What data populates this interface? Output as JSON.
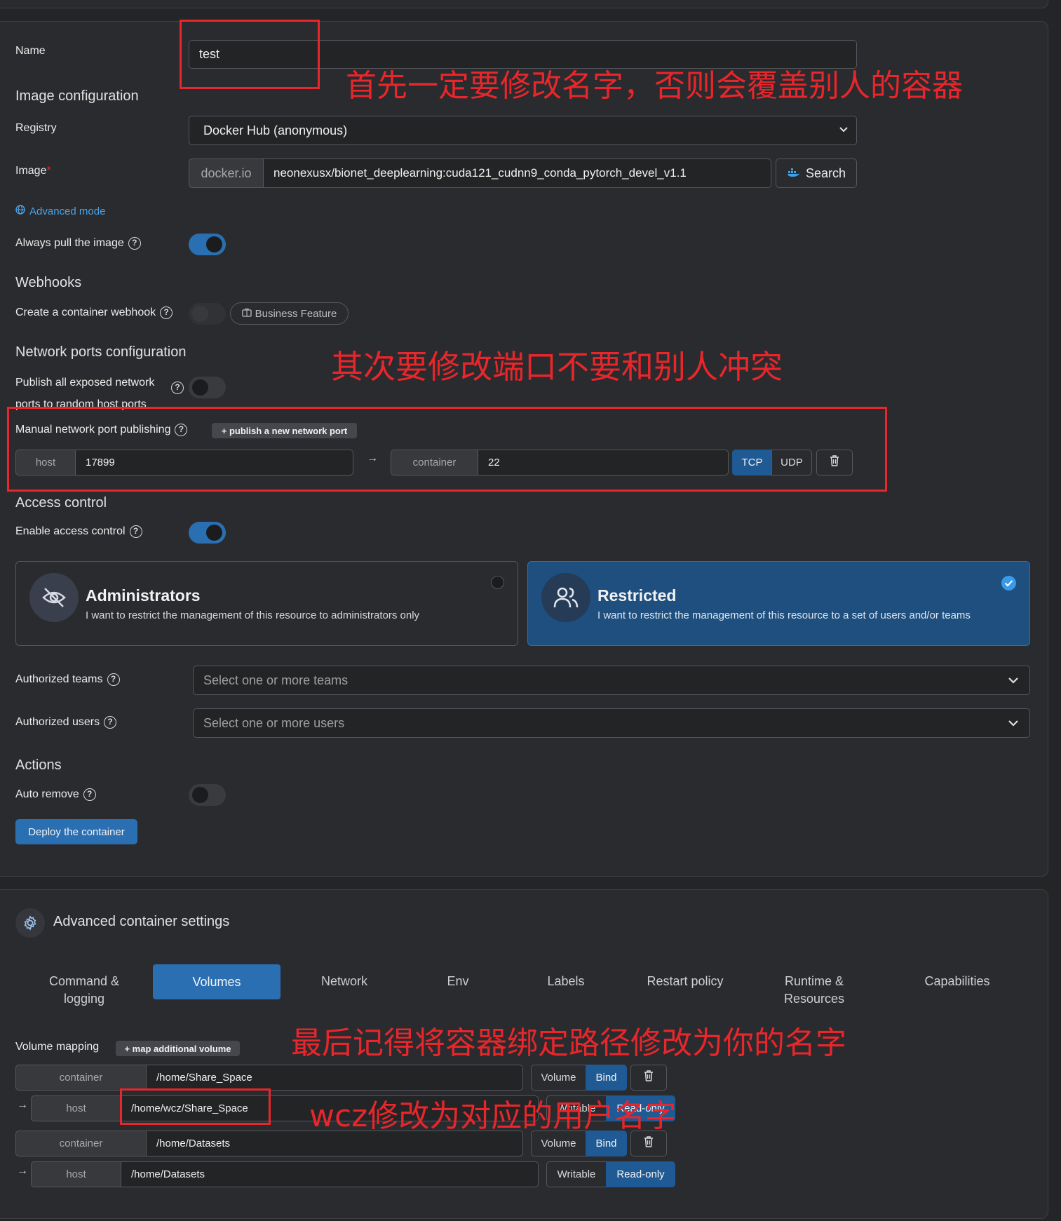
{
  "form": {
    "name_label": "Name",
    "name_value": "test",
    "image_config_title": "Image configuration",
    "registry_label": "Registry",
    "registry_value": "Docker Hub (anonymous)",
    "image_label": "Image",
    "image_required": "*",
    "image_prefix": "docker.io",
    "image_value": "neonexusx/bionet_deeplearning:cuda121_cudnn9_conda_pytorch_devel_v1.1",
    "search_label": "Search",
    "advanced_mode_label": "Advanced mode",
    "always_pull_label": "Always pull the image",
    "always_pull_on": true,
    "webhooks_title": "Webhooks",
    "webhook_label": "Create a container webhook",
    "business_feature_label": "Business Feature",
    "network_title": "Network ports configuration",
    "publish_all_label_1": "Publish all exposed network",
    "publish_all_label_2": "ports to random host ports",
    "manual_publish_label": "Manual network port publishing",
    "publish_new_port_label": "+ publish a new network port",
    "port_host_label": "host",
    "port_host_value": "17899",
    "port_container_label": "container",
    "port_container_value": "22",
    "tcp_label": "TCP",
    "udp_label": "UDP",
    "access_title": "Access control",
    "enable_access_label": "Enable access control",
    "admins_title": "Administrators",
    "admins_desc": "I want to restrict the management of this resource to administrators only",
    "restricted_title": "Restricted",
    "restricted_desc": "I want to restrict the management of this resource to a set of users and/or teams",
    "teams_label": "Authorized teams",
    "teams_placeholder": "Select one or more teams",
    "users_label": "Authorized users",
    "users_placeholder": "Select one or more users",
    "actions_title": "Actions",
    "auto_remove_label": "Auto remove",
    "deploy_label": "Deploy the container"
  },
  "advanced": {
    "title": "Advanced container settings",
    "tabs": [
      {
        "label_1": "Command &",
        "label_2": "logging"
      },
      {
        "label_1": "Volumes",
        "label_2": ""
      },
      {
        "label_1": "Network",
        "label_2": ""
      },
      {
        "label_1": "Env",
        "label_2": ""
      },
      {
        "label_1": "Labels",
        "label_2": ""
      },
      {
        "label_1": "Restart policy",
        "label_2": ""
      },
      {
        "label_1": "Runtime &",
        "label_2": "Resources"
      },
      {
        "label_1": "Capabilities",
        "label_2": ""
      }
    ],
    "active_tab": "Volumes",
    "volume_mapping_label": "Volume mapping",
    "map_volume_label": "+ map additional volume",
    "volumes": [
      {
        "container_label": "container",
        "container_value": "/home/Share_Space",
        "volume_label": "Volume",
        "bind_label": "Bind",
        "host_label": "host",
        "host_value": "/home/wcz/Share_Space",
        "writable_label": "Writable",
        "readonly_label": "Read-only"
      },
      {
        "container_label": "container",
        "container_value": "/home/Datasets",
        "volume_label": "Volume",
        "bind_label": "Bind",
        "host_label": "host",
        "host_value": "/home/Datasets",
        "writable_label": "Writable",
        "readonly_label": "Read-only"
      }
    ]
  },
  "annotations": {
    "note_name": "首先一定要修改名字，否则会覆盖别人的容器",
    "note_port": "其次要修改端口不要和别人冲突",
    "note_path": "最后记得将容器绑定路径修改为你的名字",
    "note_user": "wcz修改为对应的用户名字"
  },
  "colors": {
    "accent": "#2b6fb3",
    "annotation_red": "#e8262b",
    "background": "#242527"
  }
}
